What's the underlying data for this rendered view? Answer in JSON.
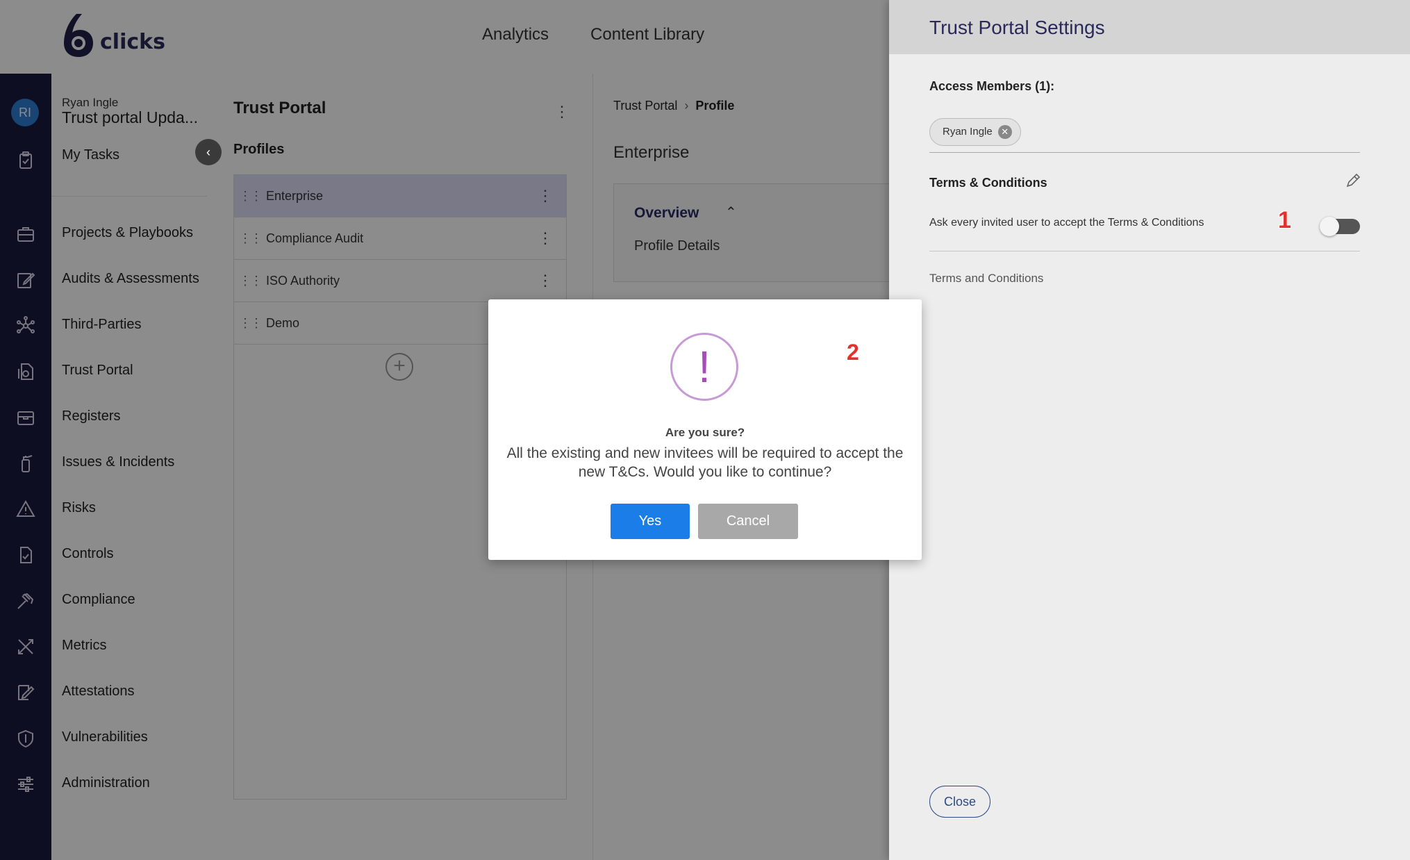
{
  "logo": {
    "text": "clicks"
  },
  "topnav": {
    "analytics": "Analytics",
    "content_library": "Content Library"
  },
  "user": {
    "initials": "RI",
    "name": "Ryan Ingle",
    "workspace": "Trust portal Upda..."
  },
  "nav": {
    "my_tasks": "My Tasks",
    "items": [
      "Projects & Playbooks",
      "Audits & Assessments",
      "Third-Parties",
      "Trust Portal",
      "Registers",
      "Issues & Incidents",
      "Risks",
      "Controls",
      "Compliance",
      "Metrics",
      "Attestations",
      "Vulnerabilities",
      "Administration"
    ]
  },
  "profiles_panel": {
    "title": "Trust Portal",
    "label": "Profiles",
    "items": [
      "Enterprise",
      "Compliance Audit",
      "ISO Authority",
      "Demo"
    ]
  },
  "content": {
    "breadcrumb": [
      "Trust Portal",
      "Profile"
    ],
    "title": "Enterprise",
    "overview_label": "Overview",
    "profile_details": "Profile Details"
  },
  "drawer": {
    "title": "Trust Portal Settings",
    "access_members_label": "Access Members (1):",
    "member_chip": "Ryan Ingle",
    "tc_label": "Terms & Conditions",
    "tc_ask": "Ask every invited user to accept the Terms & Conditions",
    "tc_link": "Terms and Conditions",
    "close_label": "Close",
    "toggle_on": false
  },
  "annotations": {
    "one": "1",
    "two": "2"
  },
  "modal": {
    "icon": "!",
    "title": "Are you sure?",
    "body": "All the existing and new invitees will be required to accept the new T&Cs. Would you like to continue?",
    "yes_label": "Yes",
    "cancel_label": "Cancel"
  },
  "colors": {
    "accent_blue": "#1a7de8",
    "rail": "#191b3f",
    "warning_purple": "#a64cb8",
    "annotation_red": "#e53030"
  }
}
